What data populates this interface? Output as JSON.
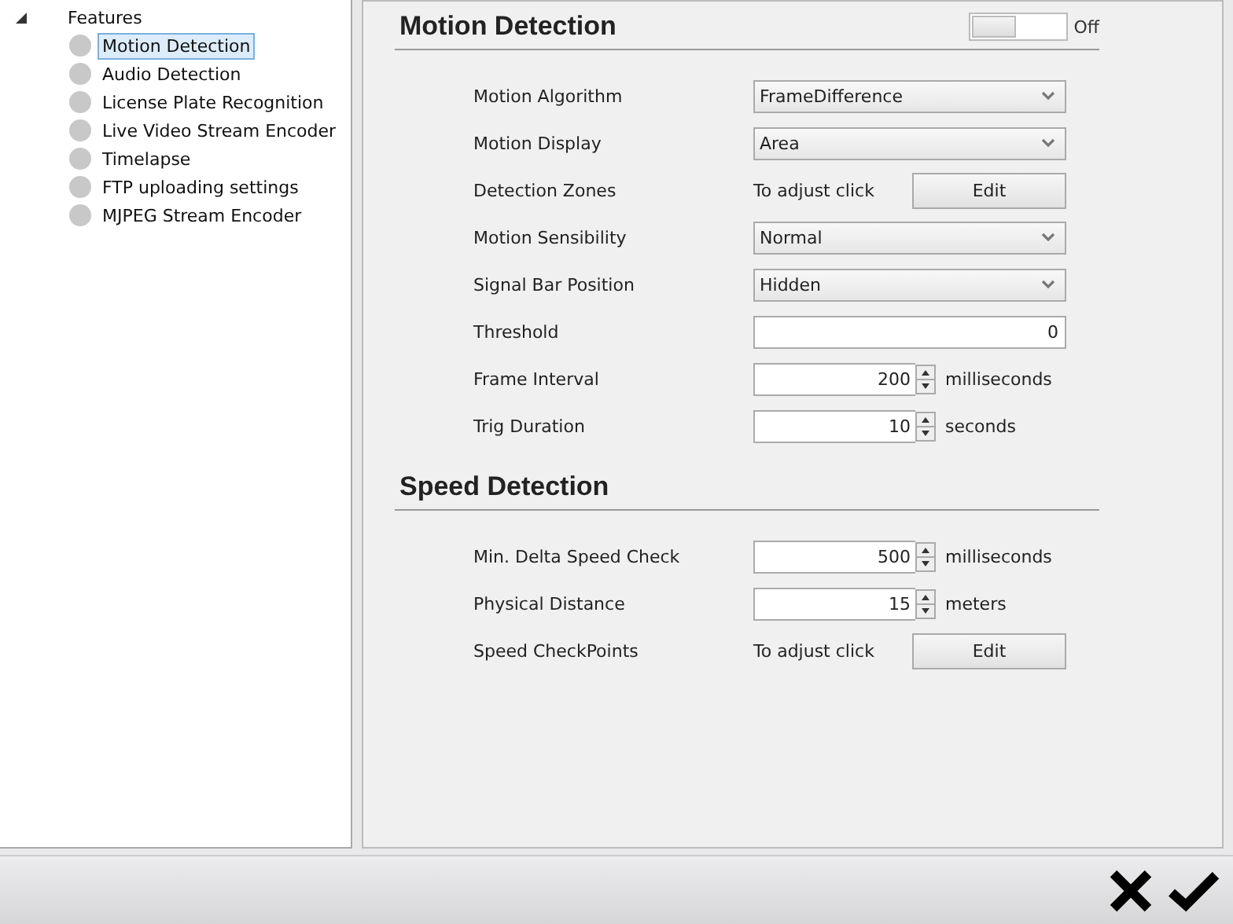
{
  "tree": {
    "label": "Features",
    "expanded": true,
    "items": [
      {
        "label": "Motion Detection",
        "selected": true
      },
      {
        "label": "Audio Detection",
        "selected": false
      },
      {
        "label": "License Plate Recognition",
        "selected": false
      },
      {
        "label": "Live Video Stream Encoder",
        "selected": false
      },
      {
        "label": "Timelapse",
        "selected": false
      },
      {
        "label": "FTP uploading settings",
        "selected": false
      },
      {
        "label": "MJPEG Stream Encoder",
        "selected": false
      }
    ]
  },
  "sections": [
    {
      "title": "Motion Detection",
      "toggle": {
        "on": false,
        "label": "Off"
      },
      "rows": [
        {
          "kind": "select",
          "label": "Motion Algorithm",
          "value": "FrameDifference"
        },
        {
          "kind": "select",
          "label": "Motion Display",
          "value": "Area"
        },
        {
          "kind": "button",
          "label": "Detection Zones",
          "note": "To adjust click",
          "button": "Edit"
        },
        {
          "kind": "select",
          "label": "Motion Sensibility",
          "value": "Normal"
        },
        {
          "kind": "select",
          "label": "Signal Bar Position",
          "value": "Hidden"
        },
        {
          "kind": "number",
          "label": "Threshold",
          "value": "0"
        },
        {
          "kind": "spin",
          "label": "Frame Interval",
          "value": "200",
          "unit": "milliseconds"
        },
        {
          "kind": "spin",
          "label": "Trig Duration",
          "value": "10",
          "unit": "seconds"
        }
      ]
    },
    {
      "title": "Speed Detection",
      "rows": [
        {
          "kind": "spin",
          "label": "Min. Delta Speed Check",
          "value": "500",
          "unit": "milliseconds"
        },
        {
          "kind": "spin",
          "label": "Physical Distance",
          "value": "15",
          "unit": "meters"
        },
        {
          "kind": "button",
          "label": "Speed CheckPoints",
          "note": "To adjust click",
          "button": "Edit"
        }
      ]
    }
  ]
}
